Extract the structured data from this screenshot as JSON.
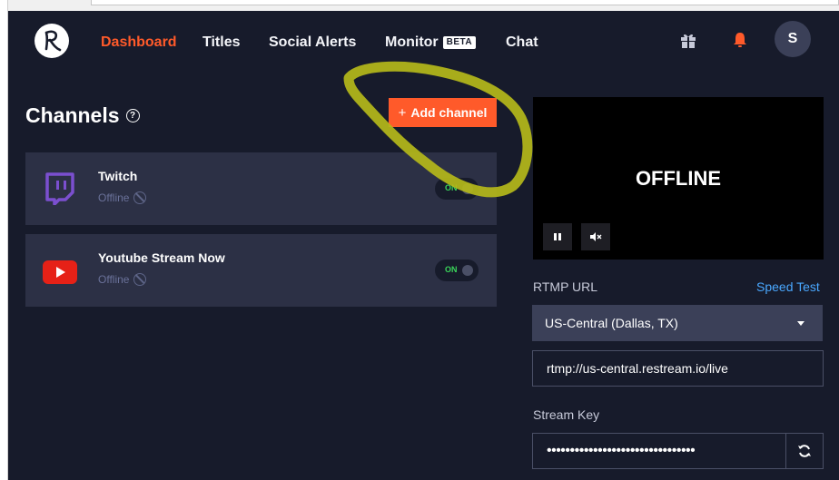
{
  "nav": {
    "logo": "restream-logo",
    "items": [
      "Dashboard",
      "Titles",
      "Social Alerts",
      "Monitor",
      "Chat"
    ],
    "beta_badge": "BETA",
    "active": "Dashboard",
    "avatar_initial": "S",
    "icons": [
      "gift-icon",
      "bell-icon"
    ]
  },
  "channels": {
    "title": "Channels",
    "add_button": "Add channel",
    "items": [
      {
        "name": "Twitch",
        "status": "Offline",
        "toggle": "ON",
        "icon": "twitch-icon"
      },
      {
        "name": "Youtube Stream Now",
        "status": "Offline",
        "toggle": "ON",
        "icon": "youtube-icon"
      }
    ]
  },
  "player": {
    "status_text": "OFFLINE",
    "controls": [
      "pause-icon",
      "mute-icon"
    ]
  },
  "rtmp": {
    "label": "RTMP URL",
    "speed_test": "Speed Test",
    "server": "US-Central (Dallas, TX)",
    "url": "rtmp://us-central.restream.io/live"
  },
  "stream_key": {
    "label": "Stream Key",
    "value": "••••••••••••••••••••••••••••••••"
  },
  "colors": {
    "background": "#171b2b",
    "card": "#2c3045",
    "accent": "#ff5a2a",
    "link": "#4aa8ff",
    "toggle_on": "#3ad65a",
    "annotation": "#b5b81a"
  }
}
